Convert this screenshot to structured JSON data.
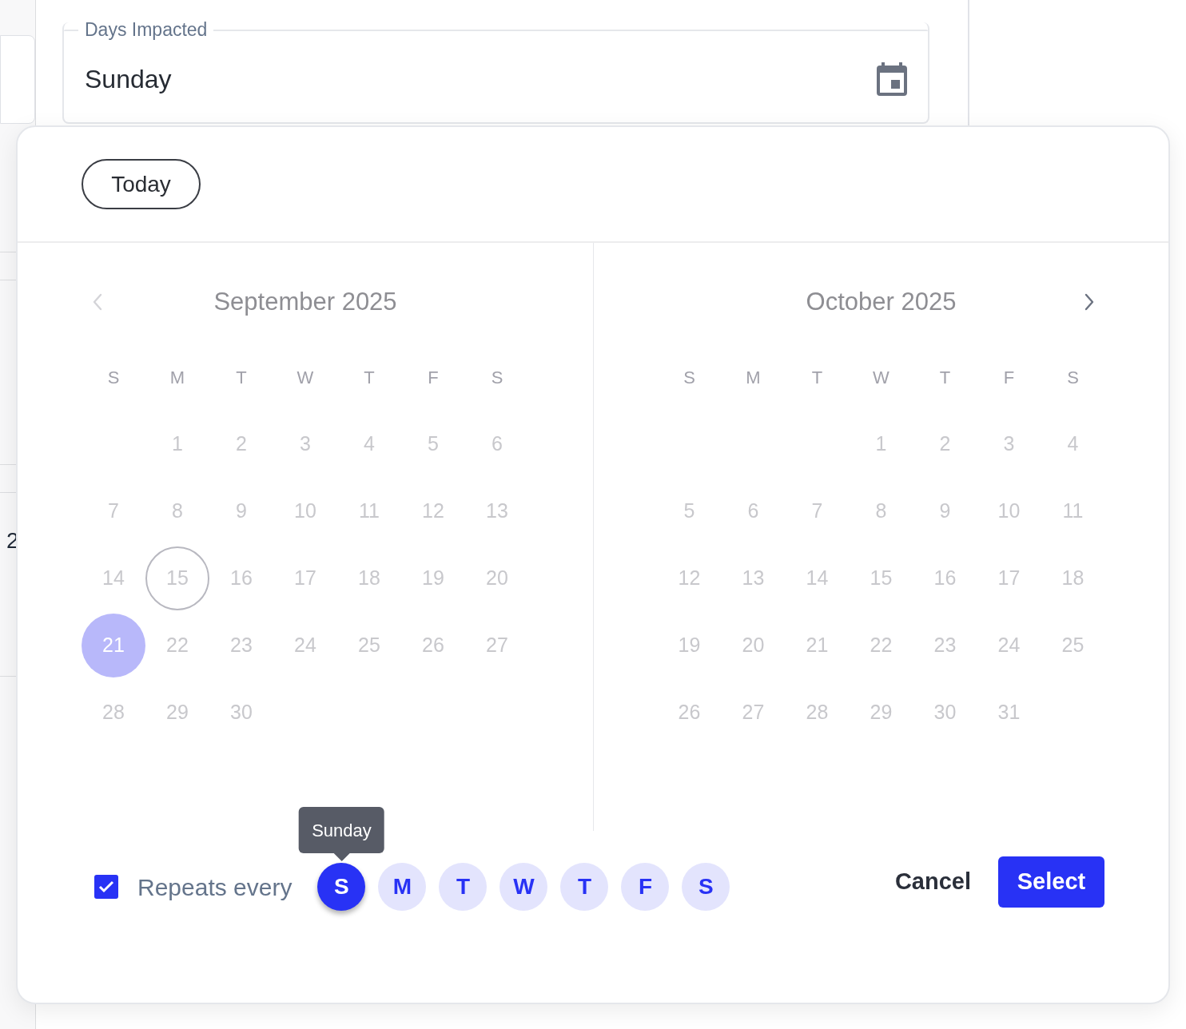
{
  "background": {
    "cut_text": "2"
  },
  "field": {
    "label": "Days Impacted",
    "value": "Sunday"
  },
  "picker": {
    "today_button": "Today",
    "nav": {
      "prev_disabled": true,
      "next_disabled": false
    },
    "months": [
      {
        "title": "September 2025",
        "weekdays": [
          "S",
          "M",
          "T",
          "W",
          "T",
          "F",
          "S"
        ],
        "weeks": [
          [
            {
              "label": "1",
              "today": false,
              "selected": false
            },
            {
              "label": "2",
              "today": false,
              "selected": false
            },
            {
              "label": "3",
              "today": false,
              "selected": false
            },
            {
              "label": "4",
              "today": false,
              "selected": false
            },
            {
              "label": "5",
              "today": false,
              "selected": false
            },
            {
              "label": "6",
              "today": false,
              "selected": false
            }
          ],
          [
            {
              "label": "7",
              "today": false,
              "selected": false
            },
            {
              "label": "8",
              "today": false,
              "selected": false
            },
            {
              "label": "9",
              "today": false,
              "selected": false
            },
            {
              "label": "10",
              "today": false,
              "selected": false
            },
            {
              "label": "11",
              "today": false,
              "selected": false
            },
            {
              "label": "12",
              "today": false,
              "selected": false
            },
            {
              "label": "13",
              "today": false,
              "selected": false
            }
          ],
          [
            {
              "label": "14",
              "today": false,
              "selected": false
            },
            {
              "label": "15",
              "today": true,
              "selected": false
            },
            {
              "label": "16",
              "today": false,
              "selected": false
            },
            {
              "label": "17",
              "today": false,
              "selected": false
            },
            {
              "label": "18",
              "today": false,
              "selected": false
            },
            {
              "label": "19",
              "today": false,
              "selected": false
            },
            {
              "label": "20",
              "today": false,
              "selected": false
            }
          ],
          [
            {
              "label": "21",
              "today": false,
              "selected": true
            },
            {
              "label": "22",
              "today": false,
              "selected": false
            },
            {
              "label": "23",
              "today": false,
              "selected": false
            },
            {
              "label": "24",
              "today": false,
              "selected": false
            },
            {
              "label": "25",
              "today": false,
              "selected": false
            },
            {
              "label": "26",
              "today": false,
              "selected": false
            },
            {
              "label": "27",
              "today": false,
              "selected": false
            }
          ],
          [
            {
              "label": "28",
              "today": false,
              "selected": false
            },
            {
              "label": "29",
              "today": false,
              "selected": false
            },
            {
              "label": "30",
              "today": false,
              "selected": false
            }
          ]
        ]
      },
      {
        "title": "October 2025",
        "weekdays": [
          "S",
          "M",
          "T",
          "W",
          "T",
          "F",
          "S"
        ],
        "weeks": [
          [
            {
              "label": "1",
              "today": false,
              "selected": false
            },
            {
              "label": "2",
              "today": false,
              "selected": false
            },
            {
              "label": "3",
              "today": false,
              "selected": false
            },
            {
              "label": "4",
              "today": false,
              "selected": false
            }
          ],
          [
            {
              "label": "5",
              "today": false,
              "selected": false
            },
            {
              "label": "6",
              "today": false,
              "selected": false
            },
            {
              "label": "7",
              "today": false,
              "selected": false
            },
            {
              "label": "8",
              "today": false,
              "selected": false
            },
            {
              "label": "9",
              "today": false,
              "selected": false
            },
            {
              "label": "10",
              "today": false,
              "selected": false
            },
            {
              "label": "11",
              "today": false,
              "selected": false
            }
          ],
          [
            {
              "label": "12",
              "today": false,
              "selected": false
            },
            {
              "label": "13",
              "today": false,
              "selected": false
            },
            {
              "label": "14",
              "today": false,
              "selected": false
            },
            {
              "label": "15",
              "today": false,
              "selected": false
            },
            {
              "label": "16",
              "today": false,
              "selected": false
            },
            {
              "label": "17",
              "today": false,
              "selected": false
            },
            {
              "label": "18",
              "today": false,
              "selected": false
            }
          ],
          [
            {
              "label": "19",
              "today": false,
              "selected": false
            },
            {
              "label": "20",
              "today": false,
              "selected": false
            },
            {
              "label": "21",
              "today": false,
              "selected": false
            },
            {
              "label": "22",
              "today": false,
              "selected": false
            },
            {
              "label": "23",
              "today": false,
              "selected": false
            },
            {
              "label": "24",
              "today": false,
              "selected": false
            },
            {
              "label": "25",
              "today": false,
              "selected": false
            }
          ],
          [
            {
              "label": "26",
              "today": false,
              "selected": false
            },
            {
              "label": "27",
              "today": false,
              "selected": false
            },
            {
              "label": "28",
              "today": false,
              "selected": false
            },
            {
              "label": "29",
              "today": false,
              "selected": false
            },
            {
              "label": "30",
              "today": false,
              "selected": false
            },
            {
              "label": "31",
              "today": false,
              "selected": false
            }
          ]
        ]
      }
    ],
    "repeat": {
      "checked": true,
      "label": "Repeats every",
      "tooltip": "Sunday",
      "days": [
        {
          "label": "S",
          "selected": true
        },
        {
          "label": "M",
          "selected": false
        },
        {
          "label": "T",
          "selected": false
        },
        {
          "label": "W",
          "selected": false
        },
        {
          "label": "T",
          "selected": false
        },
        {
          "label": "F",
          "selected": false
        },
        {
          "label": "S",
          "selected": false
        }
      ]
    },
    "buttons": {
      "cancel": "Cancel",
      "select": "Select"
    }
  }
}
